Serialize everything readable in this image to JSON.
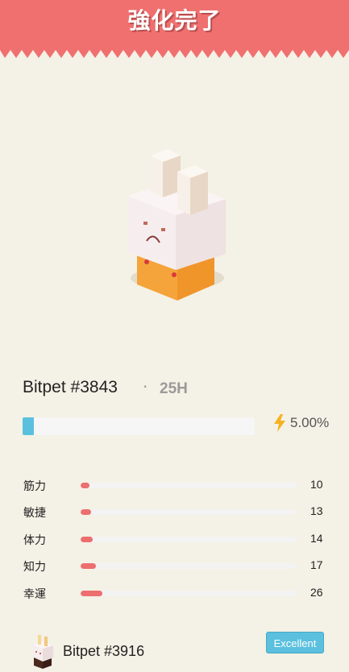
{
  "header": {
    "title": "強化完了",
    "color": "#f07070"
  },
  "pet": {
    "name": "Bitpet #3843",
    "separator": "·",
    "level": "25H"
  },
  "energy": {
    "value": 0.05,
    "text": "5.00%",
    "bar_color": "#5bc0de",
    "icon": "lightning-icon"
  },
  "stats": [
    {
      "label": "筋力",
      "value": "10",
      "fill": 0.04
    },
    {
      "label": "敏捷",
      "value": "13",
      "fill": 0.05
    },
    {
      "label": "体力",
      "value": "14",
      "fill": 0.055
    },
    {
      "label": "知力",
      "value": "17",
      "fill": 0.07
    },
    {
      "label": "幸運",
      "value": "26",
      "fill": 0.1
    }
  ],
  "footer": {
    "pet_name": "Bitpet #3916",
    "badge": "Excellent"
  }
}
